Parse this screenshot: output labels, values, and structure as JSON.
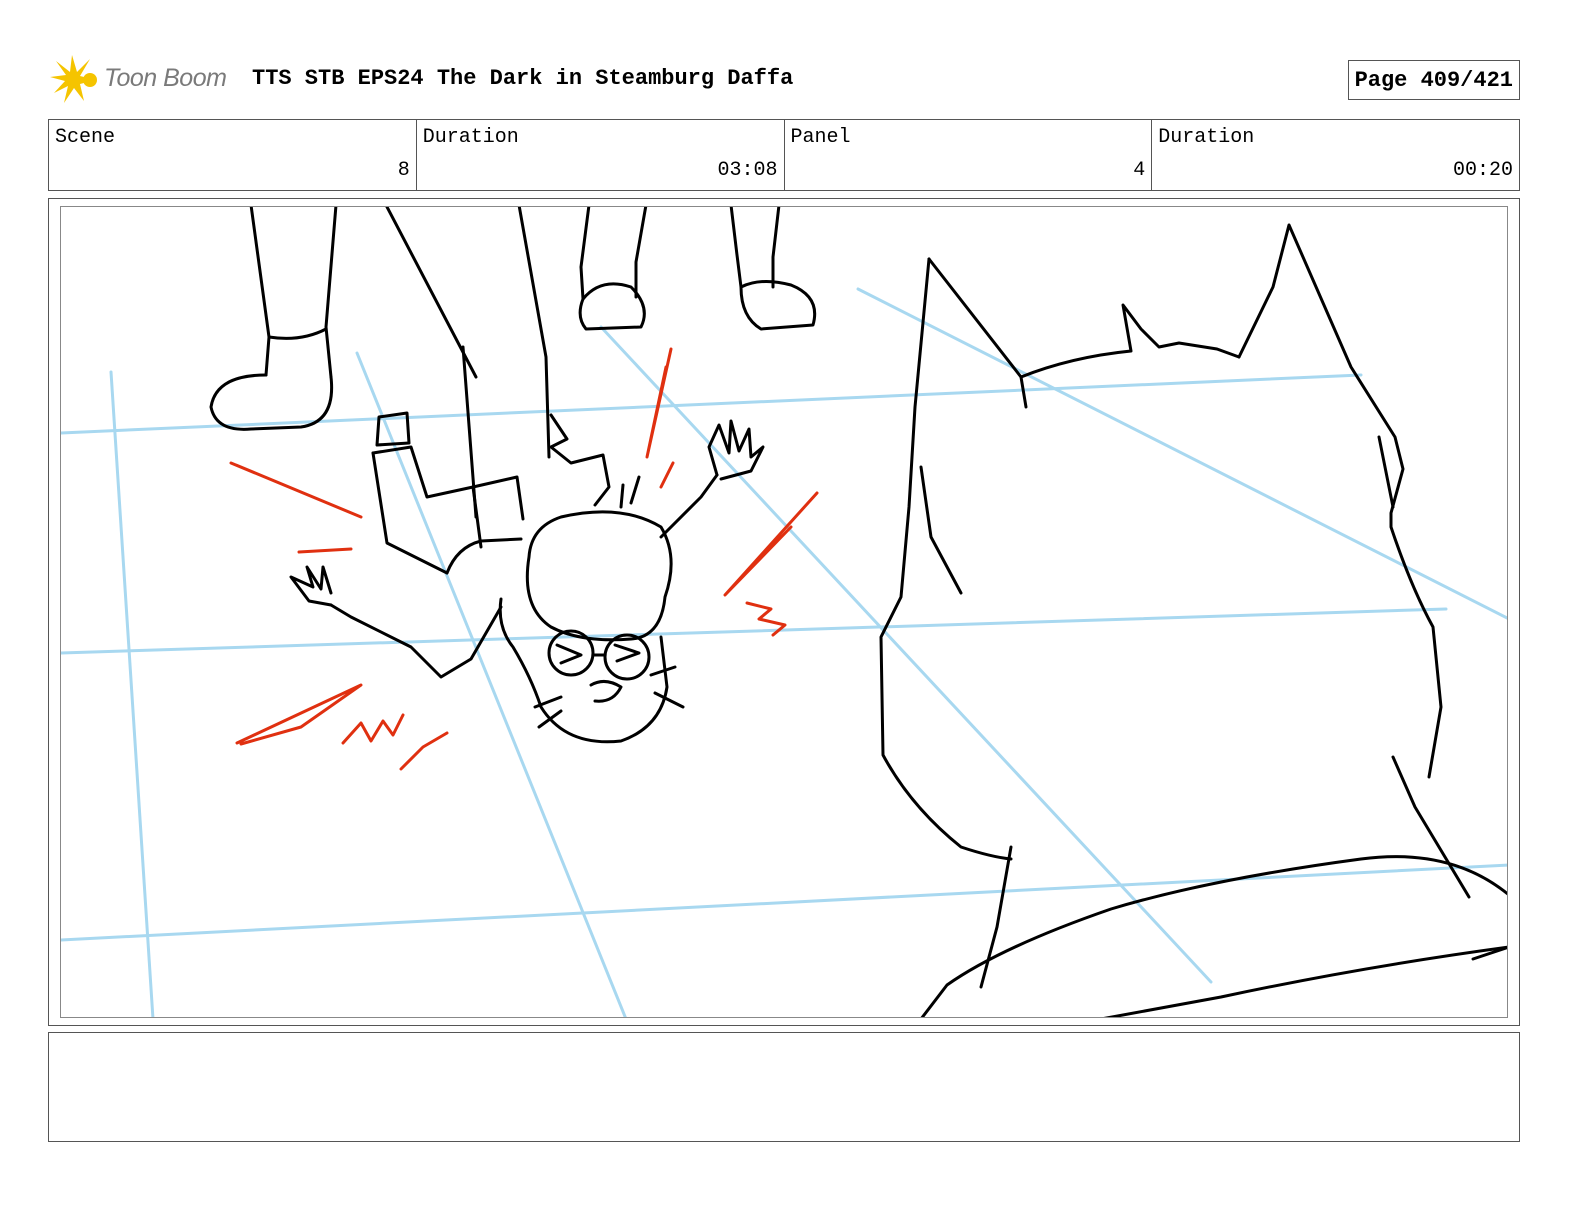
{
  "header": {
    "logo_text": "Toon Boom",
    "title": "TTS STB EPS24 The Dark in Steamburg Daffa",
    "page": "Page 409/421"
  },
  "info": {
    "scene_label": "Scene",
    "scene_value": "8",
    "scene_duration_label": "Duration",
    "scene_duration_value": "03:08",
    "panel_label": "Panel",
    "panel_value": "4",
    "panel_duration_label": "Duration",
    "panel_duration_value": "00:20"
  },
  "colors": {
    "logo_star": "#f5c400",
    "guide_lines": "#a8d8f0",
    "impact_lines": "#e03010",
    "ink": "#000000"
  },
  "notes": {
    "text": ""
  }
}
